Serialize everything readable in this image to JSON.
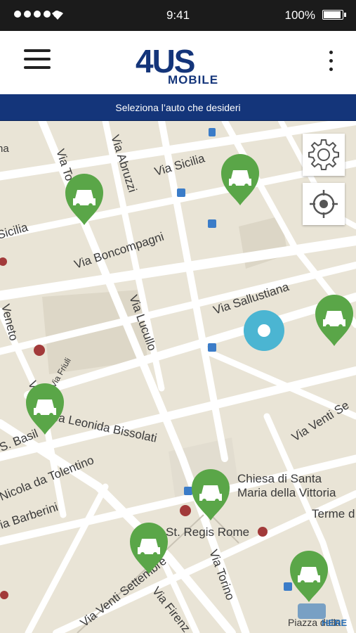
{
  "status_bar": {
    "time": "9:41",
    "battery": "100%"
  },
  "header": {
    "logo_main": "4US",
    "logo_sub": "MOBILE"
  },
  "subheader": {
    "text": "Seleziona l’auto che desideri"
  },
  "map": {
    "street_labels": [
      "Via Sicilia",
      "Via Abruzzi",
      "Via To",
      "Sicilia",
      "Via Boncompagni",
      "Via Sallustiana",
      "Via Lucullo",
      "Veneto",
      "Via Friuli",
      "Via",
      "Via Leonida Bissolati",
      "S. Basil",
      "Via Venti Se",
      "Nicola da Tolentino",
      "Chiesa di Santa",
      "Maria della Vittoria",
      "Terme d",
      "ia Barberini",
      "The St. Regis Rome",
      "Via Torino",
      "Via Venti Settembre",
      "Via Firenz",
      "Piazza della",
      "na"
    ],
    "cars_available": 7,
    "copyright": "HERE"
  },
  "colors": {
    "brand_blue": "#14357a",
    "brand_yellow": "#f5c400",
    "car_pin": "#5aa648",
    "user_location": "#4bb5d2"
  },
  "icons": {
    "menu": "hamburger-icon",
    "more": "more-vertical-icon",
    "settings": "gear-icon",
    "locate": "crosshair-icon",
    "car": "car-icon"
  }
}
